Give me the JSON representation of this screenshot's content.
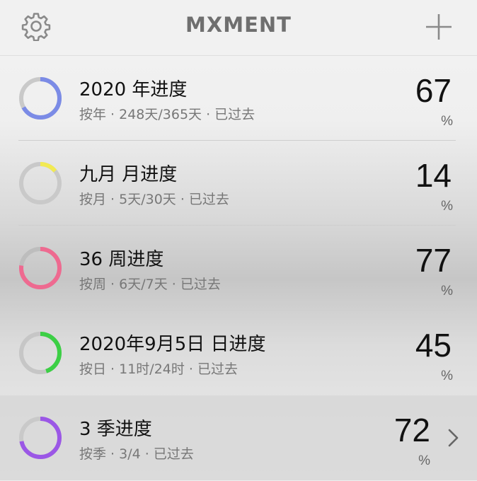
{
  "header": {
    "title": "MXMENT",
    "settings_icon": "gear-icon",
    "add_icon": "plus-icon"
  },
  "rows": [
    {
      "title": "2020 年进度",
      "subtitle": "按年 · 248天/365天 · 已过去",
      "value": "67",
      "unit": "%",
      "progress": 0.67,
      "color": "#7b8be6",
      "track": "#c9c9c9"
    },
    {
      "title": "九月 月进度",
      "subtitle": "按月 · 5天/30天 · 已过去",
      "value": "14",
      "unit": "%",
      "progress": 0.14,
      "color": "#f2ea52",
      "track": "#c9c9c9"
    },
    {
      "title": "36 周进度",
      "subtitle": "按周 · 6天/7天 · 已过去",
      "value": "77",
      "unit": "%",
      "progress": 0.77,
      "color": "#ee6a90",
      "track": "#bdbdbd"
    },
    {
      "title": "2020年9月5日 日进度",
      "subtitle": "按日 · 11时/24时 · 已过去",
      "value": "45",
      "unit": "%",
      "progress": 0.45,
      "color": "#3ccf45",
      "track": "#c6c6c6"
    },
    {
      "title": "3 季进度",
      "subtitle": "按季 · 3/4 · 已过去",
      "value": "72",
      "unit": "%",
      "progress": 0.72,
      "color": "#9b57e6",
      "track": "#c9c9c9"
    }
  ],
  "chevron_icon": "chevron-right-icon"
}
